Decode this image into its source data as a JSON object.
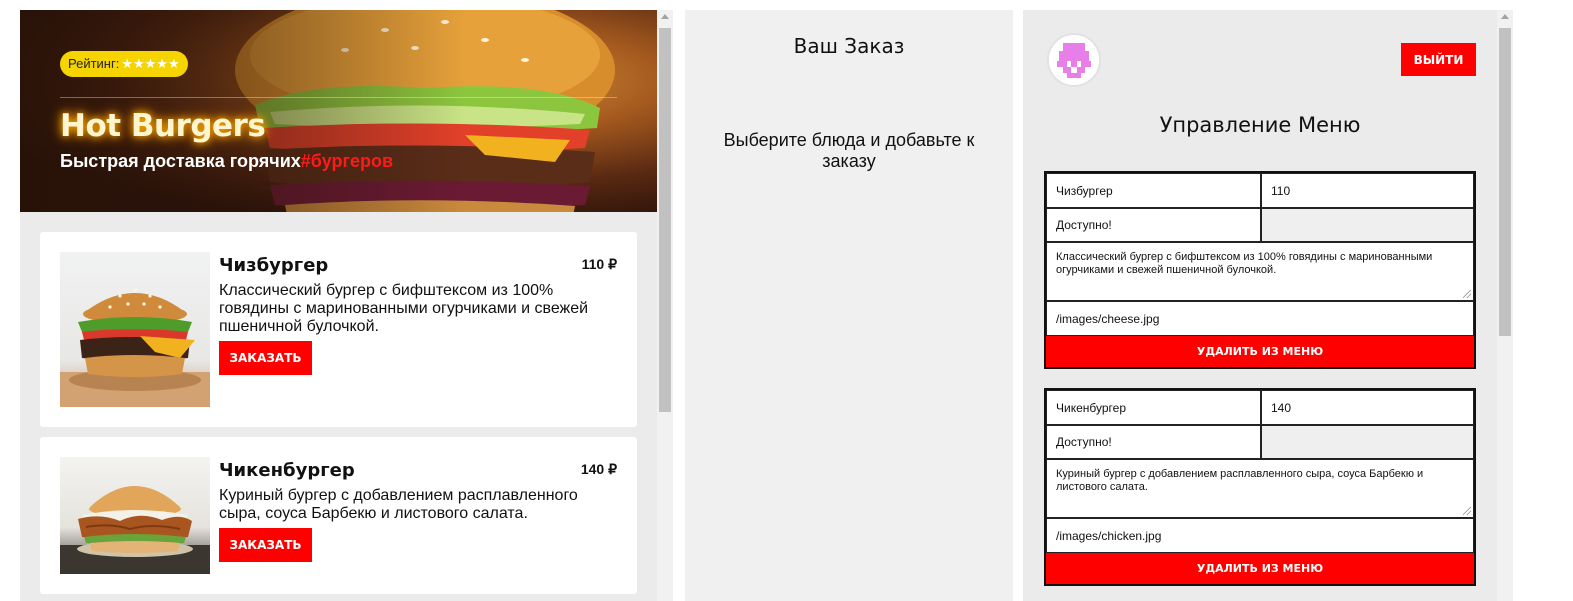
{
  "hero": {
    "rating_label": "Рейтинг:",
    "rating_stars": "★★★★★",
    "title": "Hot Burgers",
    "subtitle_main": "Быстрая доставка горячих",
    "subtitle_accent": "#бургеров"
  },
  "menu": {
    "items": [
      {
        "name": "Чизбургер",
        "price": "110 ₽",
        "description": "Классический бургер с бифштексом из 100% говядины с маринованными огурчиками и свежей пшеничной булочкой.",
        "order_label": "Заказать"
      },
      {
        "name": "Чикенбургер",
        "price": "140 ₽",
        "description": "Куриный бургер с добавлением расплавленного сыра, соуса Барбекю и листового салата.",
        "order_label": "Заказать"
      }
    ]
  },
  "order": {
    "title": "Ваш Заказ",
    "empty_message": "Выберите блюда и добавьте к заказу"
  },
  "admin": {
    "logout_label": "ВЫЙТИ",
    "title": "Управление Меню",
    "forms": [
      {
        "name": "Чизбургер",
        "price": "110",
        "status": "Доступно!",
        "description": "Классический бургер с бифштексом из 100% говядины с маринованными огурчиками и свежей пшеничной булочкой.",
        "image": "/images/cheese.jpg",
        "delete_label": "УДАЛИТЬ ИЗ МЕНЮ"
      },
      {
        "name": "Чикенбургер",
        "price": "140",
        "status": "Доступно!",
        "description": "Куриный бургер с добавлением расплавленного сыра, соуса Барбекю и листового салата.",
        "image": "/images/chicken.jpg",
        "delete_label": "УДАЛИТЬ ИЗ МЕНЮ"
      }
    ]
  },
  "colors": {
    "accent": "#ff0000",
    "rating_badge": "#f5d400",
    "hero_title_glow": "#ffb300"
  }
}
